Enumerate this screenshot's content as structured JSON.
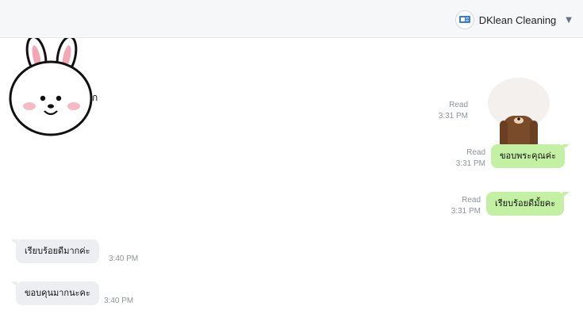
{
  "header": {
    "account_name": "DKlean Cleaning",
    "logo_icon": "company-logo-icon",
    "menu_icon": "chevron-down-icon"
  },
  "conversation": {
    "partial_text": "ก",
    "messages_out": [
      {
        "status": "Read",
        "time": "3:31 PM",
        "type": "sticker",
        "sticker": "brown-bear-bowing"
      },
      {
        "status": "Read",
        "time": "3:31 PM",
        "type": "text",
        "text": "ขอบพระคุณค่ะ"
      },
      {
        "status": "Read",
        "time": "3:31 PM",
        "type": "text",
        "text": "เรียบร้อยดีมั้ยคะ"
      }
    ],
    "messages_in": [
      {
        "type": "sticker",
        "sticker": "cony-rabbit"
      },
      {
        "time": "3:40 PM",
        "type": "text",
        "text": "เรียบร้อยดีมากค่ะ"
      },
      {
        "time": "3:40 PM",
        "type": "text",
        "text": "ขอบคุนมากนะคะ"
      }
    ]
  },
  "colors": {
    "outgoing_bubble": "#c4f0a4",
    "incoming_bubble": "#eceef1",
    "header_bg": "#f6f7f8",
    "meta_text": "#8e949b"
  }
}
